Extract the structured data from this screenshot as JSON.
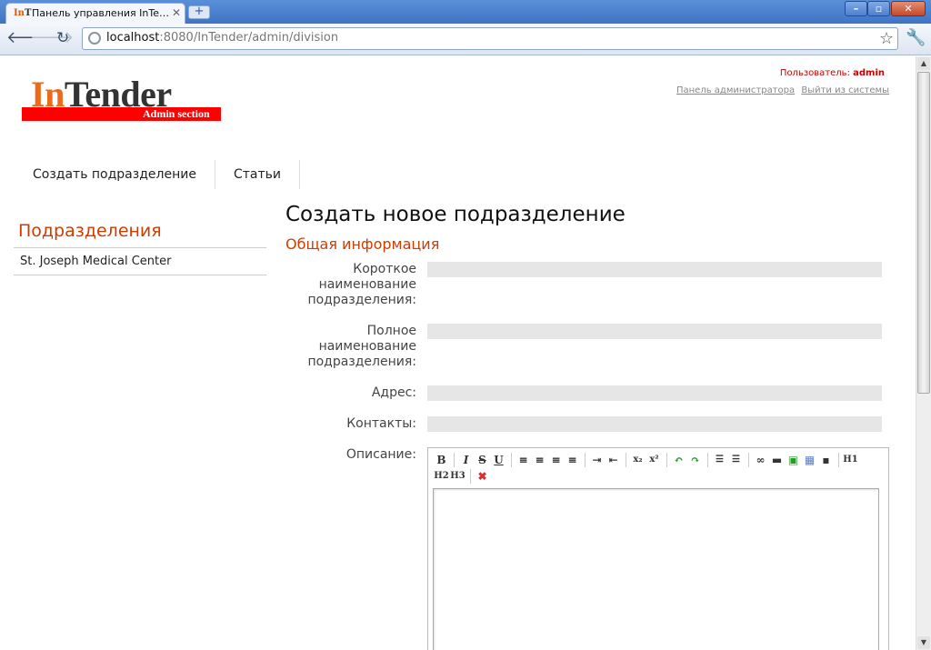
{
  "browser": {
    "tab_title": "Панель управления InTen...",
    "tab_favicon_in": "In",
    "tab_favicon_t": "T",
    "tab_close": "✕",
    "new_tab": "+",
    "url_host": "localhost",
    "url_rest": ":8080/InTender/admin/division"
  },
  "header": {
    "logo_in": "In",
    "logo_tender": "Tender",
    "logo_sub": "Admin section",
    "user_label": "Пользователь:",
    "user_name": "admin",
    "admin_panel_link": "Панель администратора",
    "logout_link": "Выйти из системы"
  },
  "menu": {
    "items": [
      {
        "label": "Создать подразделение"
      },
      {
        "label": "Статьи"
      }
    ]
  },
  "sidebar": {
    "title": "Подразделения",
    "items": [
      {
        "label": "St. Joseph Medical Center"
      }
    ]
  },
  "main": {
    "page_title": "Создать новое подразделение",
    "section_title": "Общая информация",
    "fields": {
      "short_name_label": "Короткое наименование подразделения:",
      "short_name_value": "",
      "full_name_label": "Полное наименование подразделения:",
      "full_name_value": "",
      "address_label": "Адрес:",
      "address_value": "",
      "contacts_label": "Контакты:",
      "contacts_value": "",
      "description_label": "Описание:"
    },
    "editor_buttons": {
      "bold": "B",
      "italic": "I",
      "strike": "S",
      "underline": "U",
      "sub": "x₂",
      "sup": "x²",
      "h1": "H1",
      "h2": "H2",
      "h3": "H3"
    }
  }
}
